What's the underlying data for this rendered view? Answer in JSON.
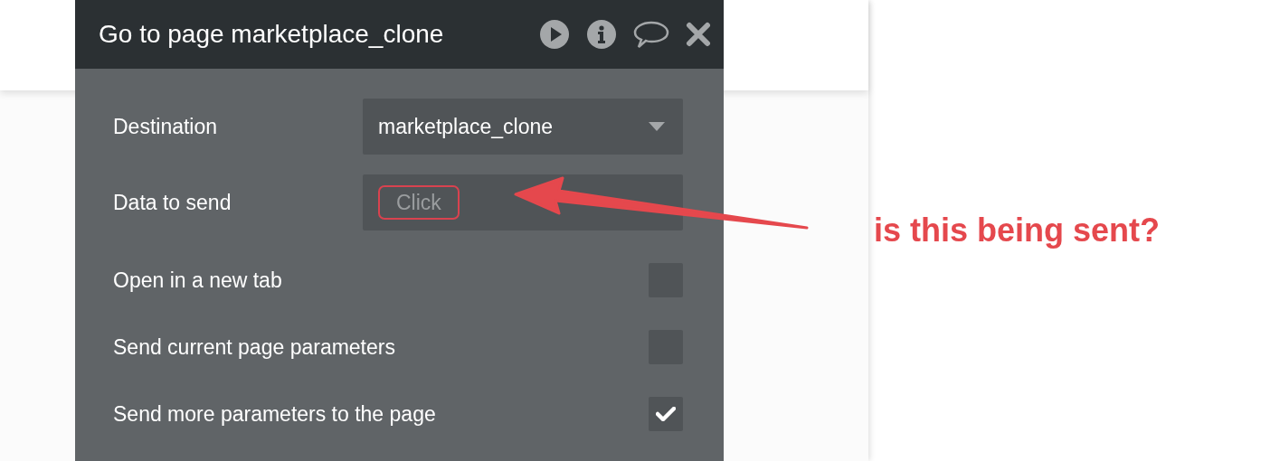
{
  "dialog": {
    "title": "Go to page marketplace_clone",
    "destination": {
      "label": "Destination",
      "value": "marketplace_clone"
    },
    "data_to_send": {
      "label": "Data to send",
      "placeholder": "Click"
    },
    "options": [
      {
        "label": "Open in a new tab",
        "checked": false
      },
      {
        "label": "Send current page parameters",
        "checked": false
      },
      {
        "label": "Send more parameters to the page",
        "checked": true
      }
    ]
  },
  "annotation": {
    "text": "is this being sent?"
  }
}
